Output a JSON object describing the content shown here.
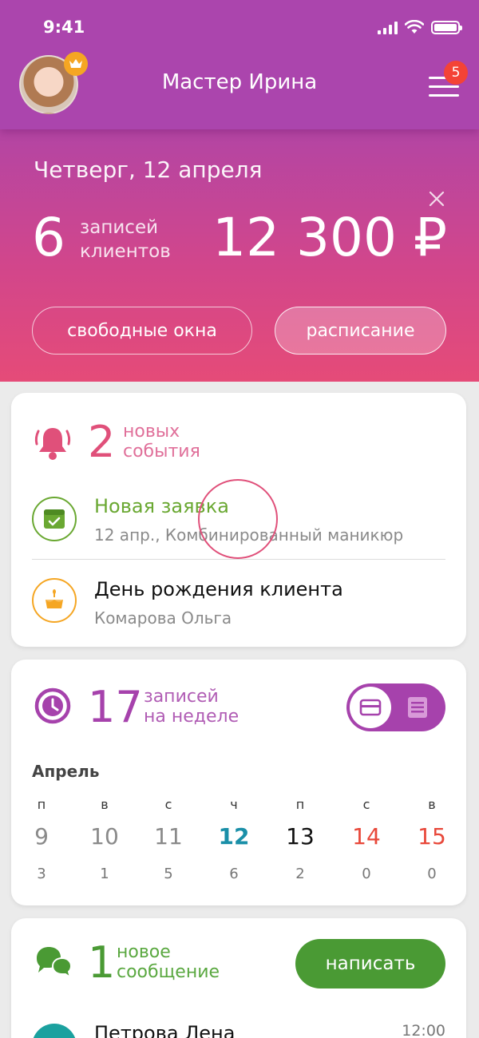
{
  "status": {
    "time": "9:41"
  },
  "header": {
    "title": "Мастер Ирина",
    "notifications_count": "5"
  },
  "summary": {
    "date": "Четверг, 12 апреля",
    "appointments_count": "6",
    "appointments_label_1": "записей",
    "appointments_label_2": "клиентов",
    "revenue": "12 300 ₽",
    "free_slots_label": "свободные окна",
    "schedule_label": "расписание"
  },
  "events": {
    "count": "2",
    "label_1": "новых",
    "label_2": "события",
    "items": [
      {
        "title": "Новая заявка",
        "subtitle": "12 апр., Комбинированный маникюр",
        "icon": "calendar-check-icon"
      },
      {
        "title": "День рождения клиента",
        "subtitle": "Комарова Ольга",
        "icon": "birthday-cake-icon"
      }
    ]
  },
  "week": {
    "count": "17",
    "label_1": "записей",
    "label_2": "на неделе",
    "month": "Апрель",
    "days": [
      {
        "wd": "п",
        "day": "9",
        "count": "3"
      },
      {
        "wd": "в",
        "day": "10",
        "count": "1"
      },
      {
        "wd": "с",
        "day": "11",
        "count": "5"
      },
      {
        "wd": "ч",
        "day": "12",
        "count": "6"
      },
      {
        "wd": "п",
        "day": "13",
        "count": "2"
      },
      {
        "wd": "с",
        "day": "14",
        "count": "0"
      },
      {
        "wd": "в",
        "day": "15",
        "count": "0"
      }
    ]
  },
  "messages": {
    "count": "1",
    "label_1": "новое",
    "label_2": "сообщение",
    "write_label": "написать",
    "first": {
      "name": "Петрова Лена",
      "time": "12:00"
    }
  },
  "colors": {
    "accent_purple": "#a642ac",
    "accent_pink": "#e0507a",
    "success_green": "#6aa832",
    "button_green": "#4a9a34",
    "today_teal": "#1a8fa8",
    "weekend_red": "#e8483a"
  }
}
